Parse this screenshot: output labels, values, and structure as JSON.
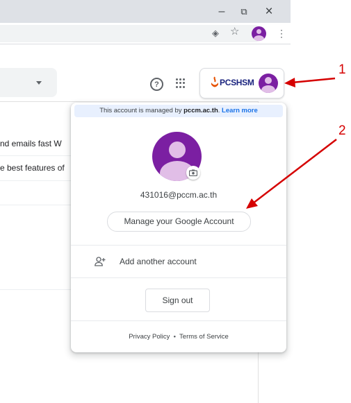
{
  "window": {
    "minimize_glyph": "–",
    "restore_glyph": "⧉",
    "close_glyph": "×"
  },
  "toolbar": {
    "icons": [
      "eye-icon",
      "star-icon",
      "avatar",
      "kebab-menu-icon"
    ],
    "star_glyph": "☆",
    "eye_glyph": "◈",
    "kebab_glyph": "⋮"
  },
  "header": {
    "help_glyph": "?",
    "logo_text": "PCSHSM"
  },
  "emails": [
    {
      "snippet": "nd emails fast W"
    },
    {
      "snippet": "e best features of"
    }
  ],
  "account_menu": {
    "managed_prefix": "This account is managed by ",
    "managed_domain": "pccm.ac.th",
    "managed_suffix": ".",
    "learn_more": "Learn more",
    "email": "431016@pccm.ac.th",
    "manage_button": "Manage your Google Account",
    "add_account": "Add another account",
    "sign_out": "Sign out",
    "privacy_policy": "Privacy Policy",
    "footer_dot": "•",
    "terms": "Terms of Service"
  },
  "annotations": {
    "label_1": "1",
    "label_2": "2"
  },
  "colors": {
    "avatar": "#7b1fa2",
    "annotation": "#d50000",
    "link": "#1a73e8"
  }
}
